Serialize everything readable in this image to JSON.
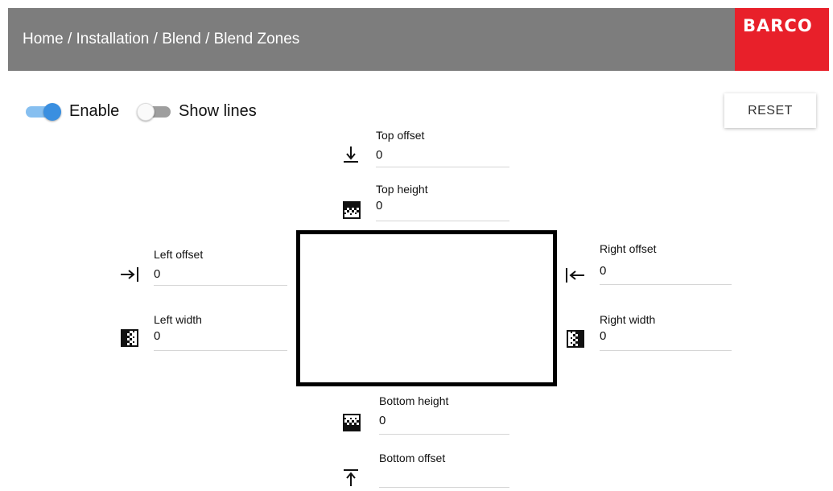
{
  "header": {
    "breadcrumb": "Home / Installation / Blend / Blend Zones",
    "logo_text": "BARCO",
    "bg_color": "#7d7d7d",
    "logo_color": "#e8202a"
  },
  "toggles": {
    "enable": {
      "label": "Enable",
      "on": true
    },
    "show_lines": {
      "label": "Show lines",
      "on": false
    }
  },
  "reset_label": "RESET",
  "accent_color": "#3a8fe0",
  "fields": {
    "top_offset": {
      "label": "Top offset",
      "value": "0",
      "icon": "arrow-down-to-line-icon"
    },
    "top_height": {
      "label": "Top height",
      "value": "0",
      "icon": "checker-gradient-icon"
    },
    "left_offset": {
      "label": "Left offset",
      "value": "0",
      "icon": "arrow-right-to-line-icon"
    },
    "left_width": {
      "label": "Left width",
      "value": "0",
      "icon": "checker-gradient-icon"
    },
    "right_offset": {
      "label": "Right offset",
      "value": "0",
      "icon": "arrow-left-from-line-icon"
    },
    "right_width": {
      "label": "Right width",
      "value": "0",
      "icon": "checker-gradient-icon"
    },
    "bottom_height": {
      "label": "Bottom height",
      "value": "0",
      "icon": "checker-gradient-icon"
    },
    "bottom_offset": {
      "label": "Bottom offset",
      "value": "",
      "icon": "arrow-up-from-line-icon"
    }
  }
}
